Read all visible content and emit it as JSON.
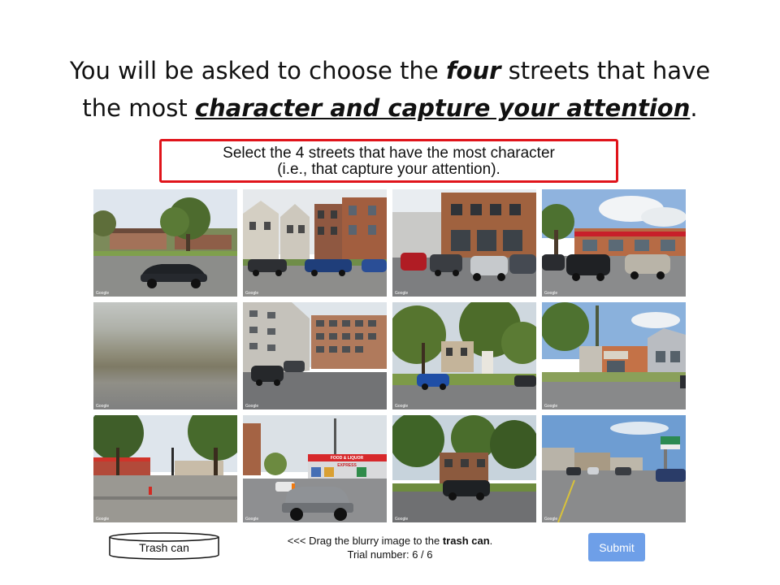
{
  "headline": {
    "line1_pre": "You will be asked to choose the ",
    "line1_em": "four",
    "line1_post": " streets that have",
    "line2_pre": "the most ",
    "line2_em": "character and capture your attention",
    "line2_post": "."
  },
  "instruction": {
    "line1": "Select the 4 streets that have the most character",
    "line2": "(i.e., that capture your attention)."
  },
  "tiles": [
    {
      "watermark": "Google",
      "icon": "street-view-image"
    },
    {
      "watermark": "Google",
      "icon": "street-view-image"
    },
    {
      "watermark": "Google",
      "icon": "street-view-image"
    },
    {
      "watermark": "Google",
      "icon": "street-view-image"
    },
    {
      "watermark": "Google",
      "icon": "blurry-image"
    },
    {
      "watermark": "Google",
      "icon": "street-view-image"
    },
    {
      "watermark": "Google",
      "icon": "street-view-image"
    },
    {
      "watermark": "Google",
      "icon": "street-view-image"
    },
    {
      "watermark": "Google",
      "icon": "street-view-image"
    },
    {
      "watermark": "Google",
      "icon": "street-view-image"
    },
    {
      "watermark": "Google",
      "icon": "street-view-image"
    },
    {
      "watermark": "Google",
      "icon": "street-view-image"
    }
  ],
  "store_sign": {
    "line1": "FOOD & LIQUOR",
    "line2": "EXPRESS"
  },
  "trash": {
    "label": "Trash can",
    "icon": "trash-can-cylinder"
  },
  "footer": {
    "drag_pre": "<<< Drag the blurry image to the ",
    "drag_bold": "trash can",
    "drag_post": ".",
    "trial": "Trial number: 6 / 6"
  },
  "submit_label": "Submit",
  "colors": {
    "instruction_border": "#e0141b",
    "submit_bg": "#6e9fe8"
  }
}
